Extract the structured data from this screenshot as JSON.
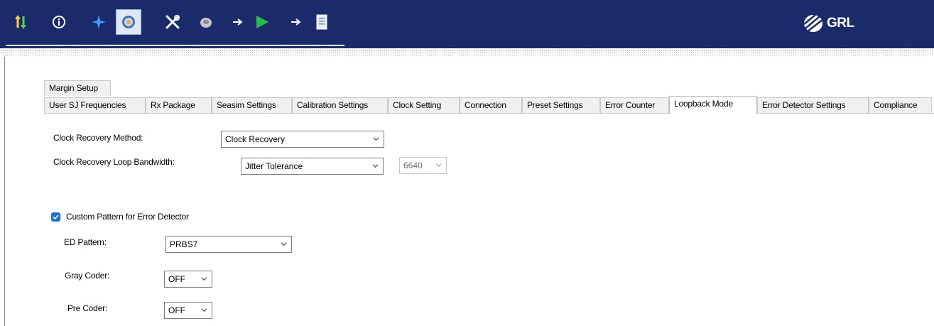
{
  "toolbar": {
    "icons": [
      "refresh-arrows-icon",
      "info-icon",
      "plus-icon",
      "settings-gear-icon",
      "tools-icon",
      "disc-icon",
      "arrow-right-icon",
      "run-play-icon",
      "arrow-right-icon",
      "report-document-icon"
    ],
    "logo_text": "GRL",
    "colors": {
      "background": "#1b2a6b",
      "play": "#22c04a",
      "plus": "#3aa0ff"
    }
  },
  "tabs": {
    "top_row": [
      "Margin Setup"
    ],
    "main_row": [
      "User SJ Frequencies",
      "Rx Package",
      "Seasim Settings",
      "Calibration Settings",
      "Clock Setting",
      "Connection",
      "Preset Settings",
      "Error Counter",
      "Loopback Mode",
      "Error Detector Settings",
      "Compliance"
    ],
    "active": "Loopback Mode"
  },
  "form": {
    "clock_recovery_method_label": "Clock Recovery Method:",
    "clock_recovery_method_value": "Clock Recovery",
    "loop_bandwidth_label": "Clock Recovery Loop Bandwidth:",
    "loop_bandwidth_value": "Jitter Tolerance",
    "loop_bandwidth_number": "6640",
    "custom_pattern_label": "Custom Pattern for Error Detector",
    "custom_pattern_checked": true,
    "ed_pattern_label": "ED Pattern:",
    "ed_pattern_value": "PRBS7",
    "gray_coder_label": "Gray Coder:",
    "gray_coder_value": "OFF",
    "pre_coder_label": "Pre Coder:",
    "pre_coder_value": "OFF"
  }
}
